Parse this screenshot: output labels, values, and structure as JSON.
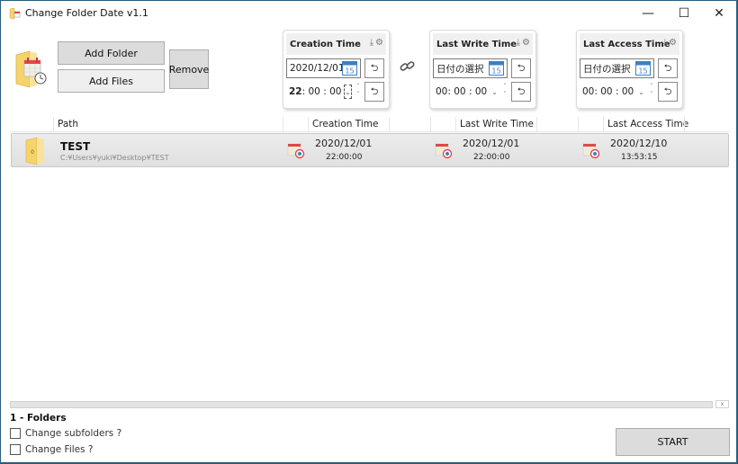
{
  "window": {
    "title": "Change Folder Date v1.1",
    "controls": {
      "minimize": "—",
      "maximize": "☐",
      "close": "✕"
    }
  },
  "toolbar": {
    "add_folder": "Add Folder",
    "add_files": "Add Files",
    "remove": "Remove"
  },
  "panels": [
    {
      "title": "Creation Time",
      "date_value": "2020/12/01",
      "time_hh": "22",
      "time_rest": " : 00 : 00",
      "reset": "⮌"
    },
    {
      "title": "Last Write Time",
      "date_value": "日付の選択",
      "time_hh": "00",
      "time_rest": " : 00 : 00",
      "reset": "⮌"
    },
    {
      "title": "Last Access Time",
      "date_value": "日付の選択",
      "time_hh": "00",
      "time_rest": " : 00 : 00",
      "reset": "⮌"
    }
  ],
  "calendar_day": "15",
  "panel_tools": {
    "download": "⤓",
    "gear": "⚙"
  },
  "grid": {
    "columns": [
      "Path",
      "Creation Time",
      "Last Write Time",
      "Last Access Time"
    ],
    "rows": [
      {
        "folder_badge": "0",
        "name": "TEST",
        "path": "C:¥Users¥yuki¥Desktop¥TEST",
        "creation_date": "2020/12/01",
        "creation_time": "22:00:00",
        "write_date": "2020/12/01",
        "write_time": "22:00:00",
        "access_date": "2020/12/10",
        "access_time": "13:53:15"
      }
    ]
  },
  "footer": {
    "scroll_close": "x",
    "count_label": "1 - Folders",
    "change_subfolders": "Change subfolders ?",
    "change_files": "Change Files ?",
    "start": "START"
  },
  "colors": {
    "window_border": "#2b5d7c",
    "button_bg": "#e1e1e1",
    "row_bg": "#e6e6e6",
    "folder_yellow": "#f6d36b",
    "calendar_red": "#e04848",
    "calendar_blue": "#3c7fc4"
  }
}
